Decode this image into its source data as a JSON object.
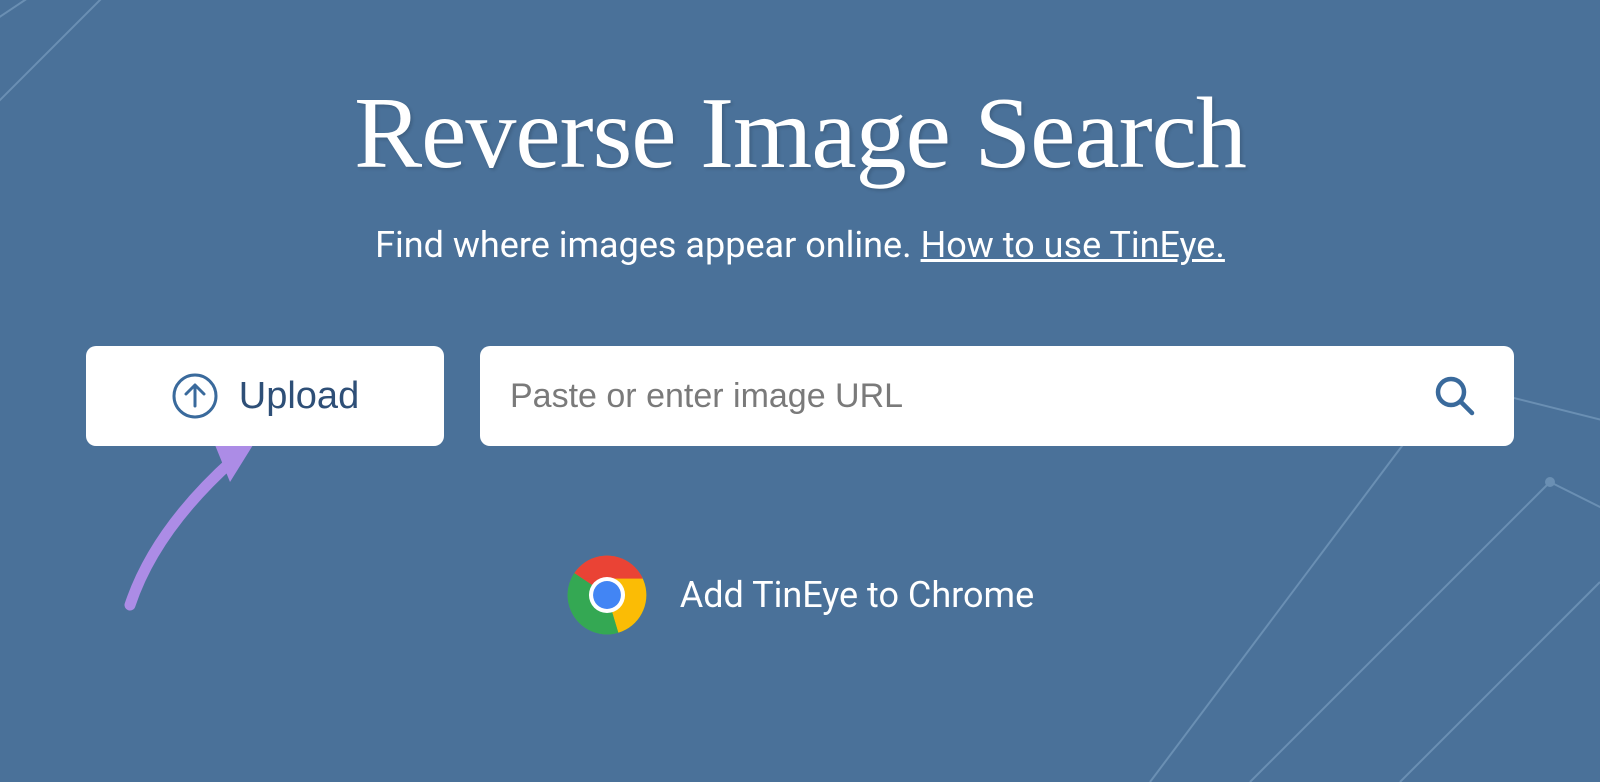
{
  "header": {
    "title": "Reverse Image Search",
    "subtitle_text": "Find where images appear online. ",
    "subtitle_link": "How to use TinEye."
  },
  "upload": {
    "label": "Upload"
  },
  "search": {
    "placeholder": "Paste or enter image URL"
  },
  "chrome": {
    "label": "Add TinEye to Chrome"
  }
}
